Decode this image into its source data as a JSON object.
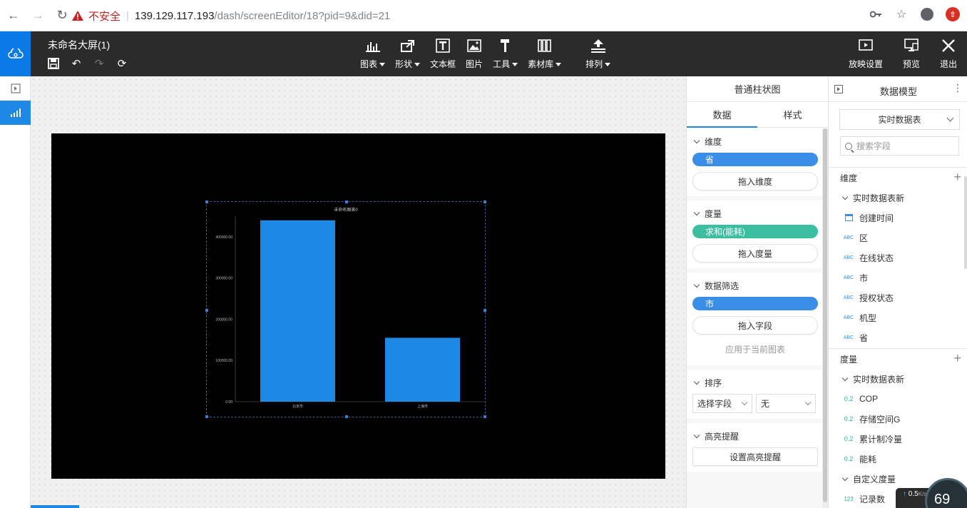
{
  "browser": {
    "insecure_label": "不安全",
    "url_host": "139.129.117.193",
    "url_path": "/dash/screenEditor/18?pid=9&did=21"
  },
  "header": {
    "doc_title": "未命名大屏(1)",
    "toolbar": [
      {
        "label": "图表",
        "icon": "bar-chart-icon",
        "has_menu": true
      },
      {
        "label": "形状",
        "icon": "share-icon",
        "has_menu": true
      },
      {
        "label": "文本框",
        "icon": "text-box-icon",
        "has_menu": false
      },
      {
        "label": "图片",
        "icon": "image-icon",
        "has_menu": false
      },
      {
        "label": "工具",
        "icon": "hammer-icon",
        "has_menu": true
      },
      {
        "label": "素材库",
        "icon": "library-icon",
        "has_menu": true
      },
      {
        "label": "排列",
        "icon": "arrange-icon",
        "has_menu": true
      }
    ],
    "right_tools": [
      {
        "label": "放映设置",
        "icon": "play-icon"
      },
      {
        "label": "预览",
        "icon": "preview-icon"
      },
      {
        "label": "退出",
        "icon": "close-icon"
      }
    ]
  },
  "chart_data": {
    "type": "bar",
    "title": "未命名图表0",
    "categories": [
      "北京市",
      "上海市"
    ],
    "values": [
      440000,
      155000
    ],
    "yticks": [
      "0.00",
      "100000.00",
      "200000.00",
      "300000.00",
      "400000.00"
    ],
    "ylim": [
      0,
      450000
    ],
    "bar_color": "#1e88e5",
    "grid": false
  },
  "config": {
    "title": "普通柱状图",
    "tabs": [
      "数据",
      "样式"
    ],
    "dimension": {
      "label": "维度",
      "pill": "省",
      "drop": "拖入维度"
    },
    "measure": {
      "label": "度量",
      "pill": "求和(能耗)",
      "drop": "拖入度量"
    },
    "filter": {
      "label": "数据筛选",
      "pill": "市",
      "drop": "拖入字段",
      "apply": "应用于当前图表"
    },
    "sort": {
      "label": "排序",
      "field": "选择字段",
      "order": "无"
    },
    "highlight": {
      "label": "高亮提醒",
      "button": "设置高亮提醒"
    }
  },
  "model": {
    "title": "数据模型",
    "table_select": "实时数据表",
    "search_placeholder": "搜索字段",
    "dimensions": {
      "label": "维度",
      "table": "实时数据表新",
      "fields": [
        {
          "name": "创建时间",
          "type": "date"
        },
        {
          "name": "区",
          "type": "ABC"
        },
        {
          "name": "在线状态",
          "type": "ABC"
        },
        {
          "name": "市",
          "type": "ABC"
        },
        {
          "name": "授权状态",
          "type": "ABC"
        },
        {
          "name": "机型",
          "type": "ABC"
        },
        {
          "name": "省",
          "type": "ABC"
        }
      ]
    },
    "measures": {
      "label": "度量",
      "table": "实时数据表新",
      "fields": [
        {
          "name": "COP",
          "type": "0.2"
        },
        {
          "name": "存储空间G",
          "type": "0.2"
        },
        {
          "name": "累计制冷量",
          "type": "0.2"
        },
        {
          "name": "能耗",
          "type": "0.2"
        }
      ],
      "custom_label": "自定义度量",
      "custom_fields": [
        {
          "name": "记录数",
          "type": "123"
        }
      ]
    }
  },
  "overlay": {
    "speed": "0.5",
    "speed_unit": "K/s",
    "percent": "69"
  }
}
